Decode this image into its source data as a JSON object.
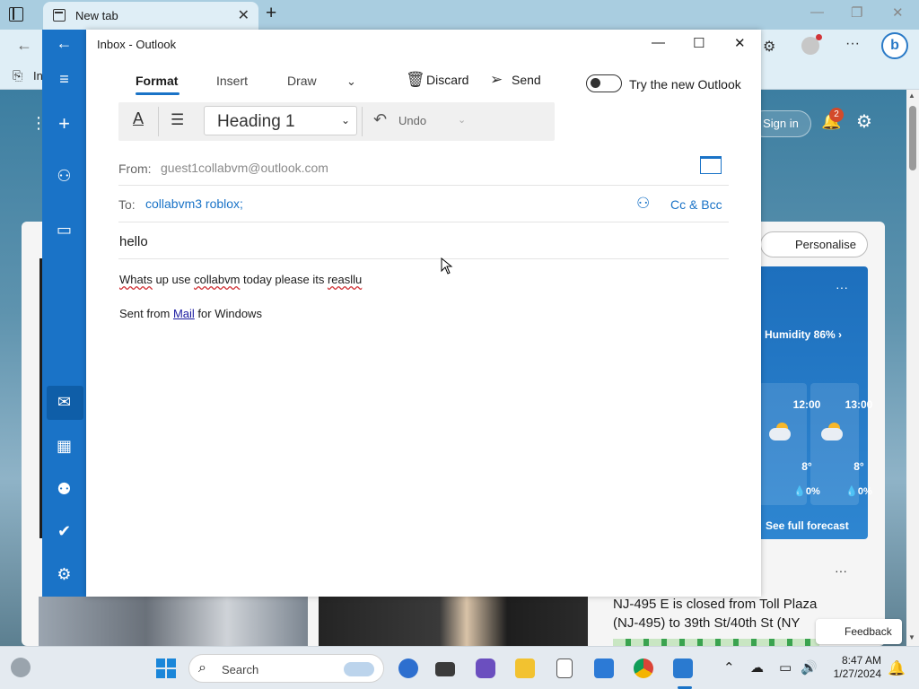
{
  "browser": {
    "tab_title": "New tab",
    "tab_close": "✕",
    "new_tab": "+",
    "window_controls": [
      "—",
      "❐",
      "✕"
    ],
    "bookmark_label": "In",
    "back": "←",
    "menu_dots": "···",
    "bing_label": "b"
  },
  "newtab_page": {
    "signin_label": "Sign in",
    "notification_count": "2",
    "personalise_label": "Personalise",
    "weather": {
      "humidity": "Humidity 86% ›",
      "forecast": [
        {
          "time": "12:00",
          "temp": "8°",
          "rain": "💧0%"
        },
        {
          "time": "13:00",
          "temp": "8°",
          "rain": "💧0%"
        }
      ],
      "see_forecast": "See full forecast"
    },
    "news_headline": "NJ-495 E is closed from Toll Plaza (NJ-495) to 39th St/40th St (NY",
    "feedback_label": "Feedback",
    "more_dots": "···"
  },
  "outlook": {
    "window_title": "Inbox - Outlook",
    "window_controls": [
      "—",
      "☐",
      "✕"
    ],
    "ribbon_tabs": [
      "Format",
      "Insert",
      "Draw"
    ],
    "discard_label": "Discard",
    "send_label": "Send",
    "try_new_label": "Try the new Outlook",
    "style_select": "Heading 1",
    "undo_label": "Undo",
    "from_label": "From:",
    "from_value": "guest1collabvm@outlook.com",
    "to_label": "To:",
    "to_value": "collabvm3 roblox;",
    "cc_bcc_label": "Cc & Bcc",
    "subject": "hello",
    "body": {
      "w1": "Whats",
      "t1": " up use ",
      "w2": "collabvm",
      "t2": " today please its ",
      "w3": "reasllu"
    },
    "signature": {
      "prefix": "Sent from ",
      "link": "Mail",
      "suffix": " for Windows"
    }
  },
  "taskbar": {
    "search_label": "Search",
    "time": "8:47 AM",
    "date": "1/27/2024"
  }
}
